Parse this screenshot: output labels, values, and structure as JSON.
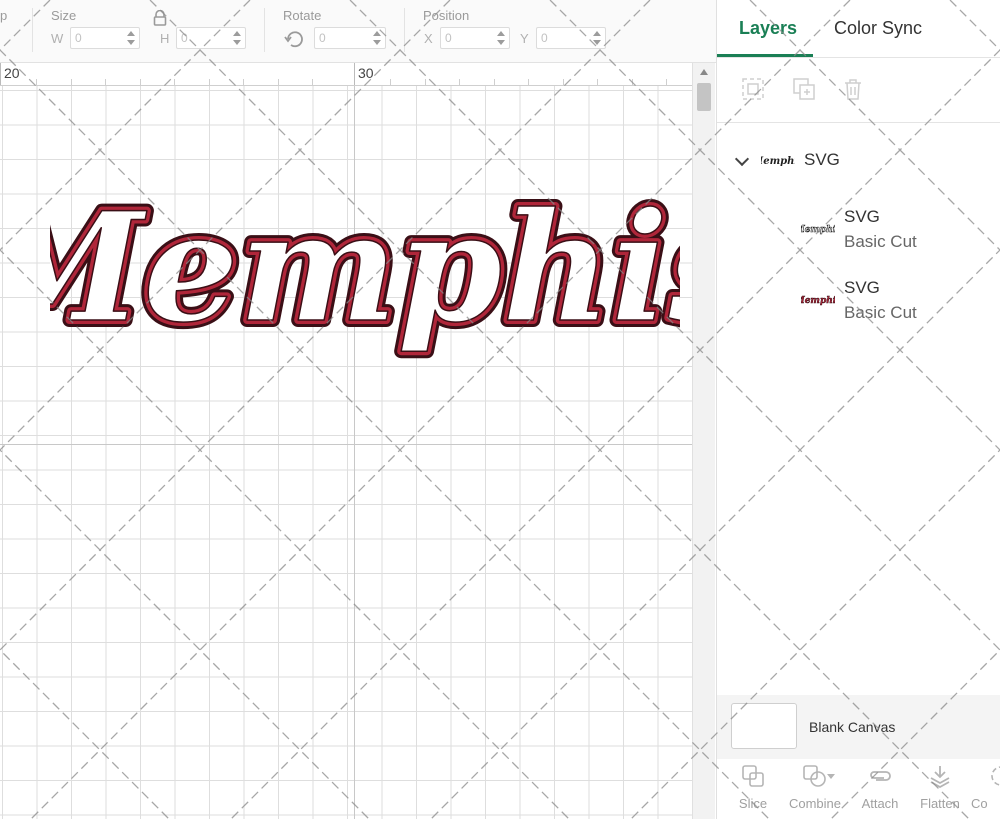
{
  "toolbar": {
    "partial_label": "p",
    "size_label": "Size",
    "w_label": "W",
    "w_value": "0",
    "h_label": "H",
    "h_value": "0",
    "rotate_label": "Rotate",
    "rotate_value": "0",
    "position_label": "Position",
    "x_label": "X",
    "x_value": "0",
    "y_label": "Y",
    "y_value": "0"
  },
  "ruler": {
    "marks": [
      "20",
      "30"
    ]
  },
  "canvas": {
    "design_name": "Memphis",
    "design_colors": {
      "fill": "#b0263a",
      "outline": "#3a0f16"
    }
  },
  "panel": {
    "tabs": [
      {
        "label": "Layers",
        "active": true
      },
      {
        "label": "Color Sync",
        "active": false
      }
    ],
    "accent_color": "#1a7f55",
    "icons": [
      "group-icon",
      "duplicate-icon",
      "delete-icon"
    ],
    "group": {
      "label": "SVG"
    },
    "layers": [
      {
        "title": "SVG",
        "subtitle": "Basic Cut"
      },
      {
        "title": "SVG",
        "subtitle": "Basic Cut"
      }
    ],
    "blank_canvas_label": "Blank Canvas",
    "actions": [
      {
        "label": "Slice",
        "icon": "slice-icon"
      },
      {
        "label": "Combine",
        "icon": "combine-icon"
      },
      {
        "label": "Attach",
        "icon": "attach-icon"
      },
      {
        "label": "Flatten",
        "icon": "flatten-icon"
      },
      {
        "label": "Co",
        "icon": "contour-icon"
      }
    ]
  }
}
